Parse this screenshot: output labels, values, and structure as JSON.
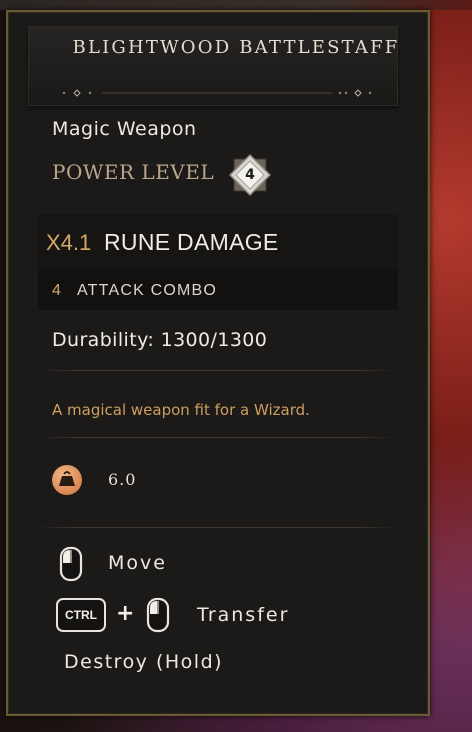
{
  "item": {
    "name": "BLIGHTWOOD BATTLESTAFF",
    "type": "Magic Weapon",
    "power_level_label": "POWER LEVEL",
    "power_level": "4"
  },
  "damage": {
    "multiplier": "X4.1",
    "label": "RUNE DAMAGE",
    "combo_count": "4",
    "combo_label": "ATTACK COMBO"
  },
  "durability": "Durability: 1300/1300",
  "description": "A magical weapon fit for a Wizard.",
  "weight": {
    "icon": "weight-icon",
    "value": "6.0"
  },
  "hints": {
    "move_label": "Move",
    "ctrl_key": "CTRL",
    "plus": "+",
    "transfer_label": "Transfer",
    "destroy_label": "Destroy (Hold)"
  },
  "colors": {
    "accent_gold": "#d6a867",
    "frame_gold": "#6a5a34",
    "text_primary": "#f1ece2",
    "panel_bg": "#1c1a19"
  }
}
